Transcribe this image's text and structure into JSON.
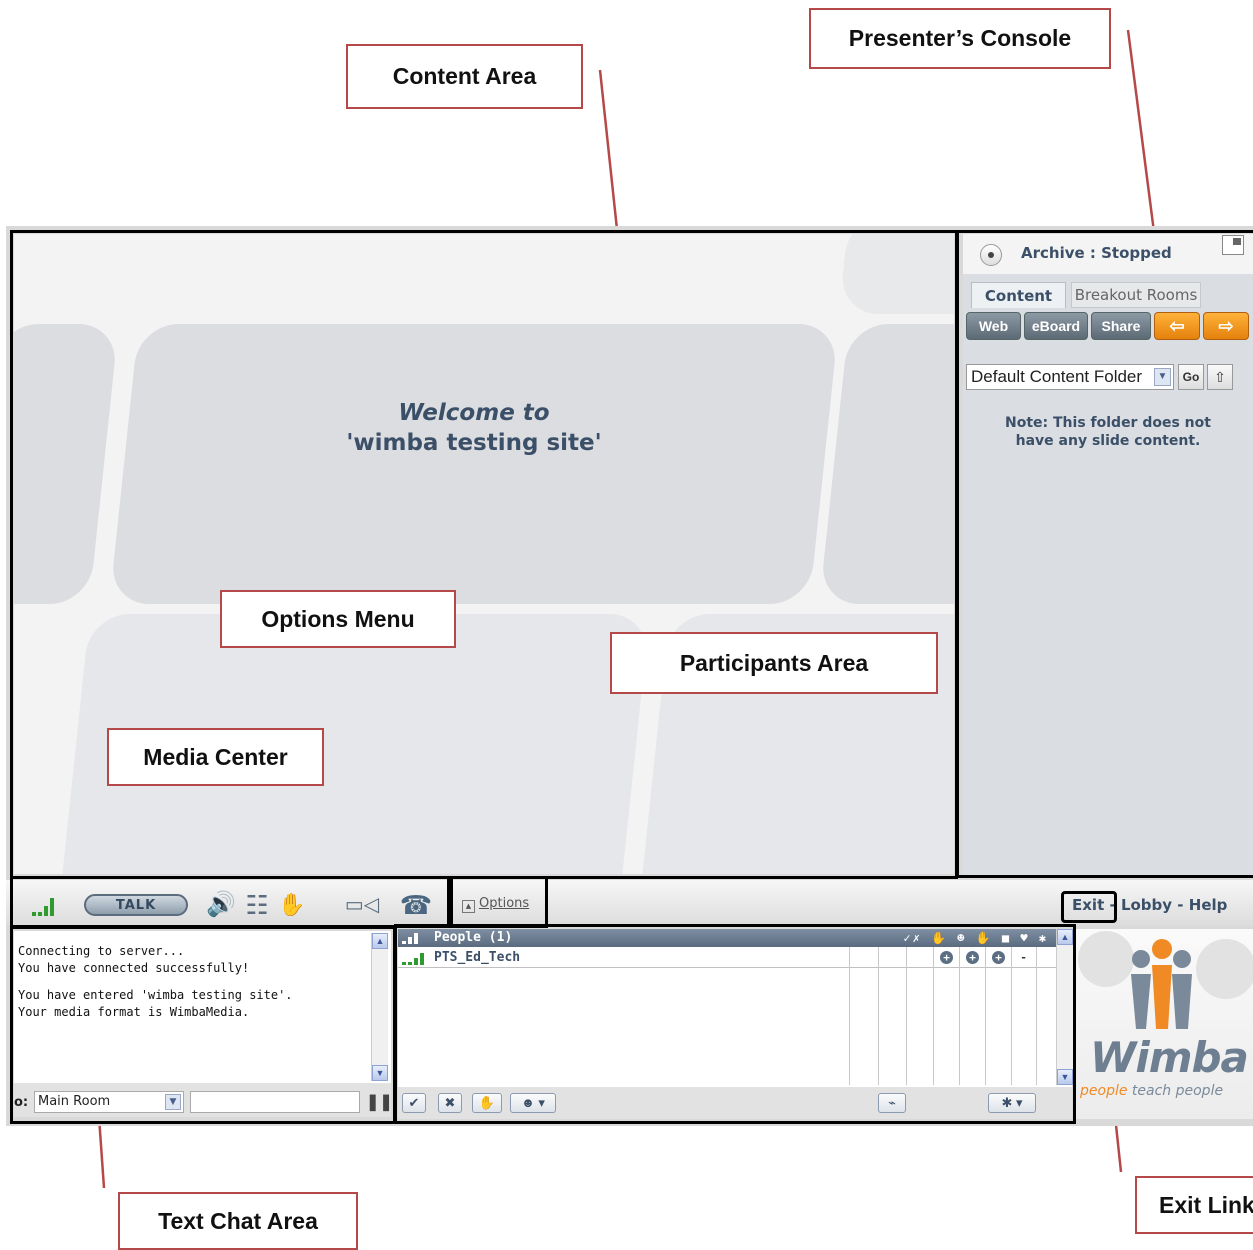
{
  "callouts": {
    "content_area": "Content Area",
    "presenters_console": "Presenter’s Console",
    "options_menu": "Options Menu",
    "participants_area": "Participants Area",
    "media_center": "Media Center",
    "text_chat_area": "Text Chat Area",
    "exit_link": "Exit Link"
  },
  "content": {
    "welcome_line1": "Welcome to",
    "welcome_line2": "'wimba testing site'"
  },
  "console": {
    "archive_status": "Archive : Stopped",
    "tabs": [
      "Content",
      "Breakout Rooms"
    ],
    "buttons": {
      "web": "Web",
      "eboard": "eBoard",
      "share": "Share",
      "prev": "⇦",
      "next": "⇨"
    },
    "folder_select": "Default Content Folder",
    "go_label": "Go",
    "note_line1": "Note: This folder does not",
    "note_line2": "have any slide content."
  },
  "toolbar": {
    "talk_label": "TALK",
    "options_label": "Options",
    "exit_label": "Exit",
    "separator": "-",
    "lobby_label": "Lobby",
    "help_label": "Help",
    "icons": [
      "signal-icon",
      "talk-button",
      "speaker-icon",
      "equalizer-icon",
      "hand-raise-icon",
      "video-camera-icon",
      "telephone-icon"
    ]
  },
  "chat": {
    "messages": [
      "Connecting to server...",
      "You have connected successfully!",
      "You have entered 'wimba testing site'.",
      "Your media format is WimbaMedia."
    ],
    "to_label": "o:",
    "room_select": "Main Room"
  },
  "people": {
    "header": "People (1)",
    "participant_name": "PTS_Ed_Tech",
    "status_icons": [
      "+",
      "+",
      "+",
      "-"
    ]
  },
  "logo": {
    "word": "Wimba",
    "tagline_a": "people",
    "tagline_b": " teach people"
  },
  "colors": {
    "callout_border": "#b5494a",
    "accent_text": "#3b5068",
    "orange_button": "#f39a1e",
    "signal_green": "#2f9a2f"
  }
}
